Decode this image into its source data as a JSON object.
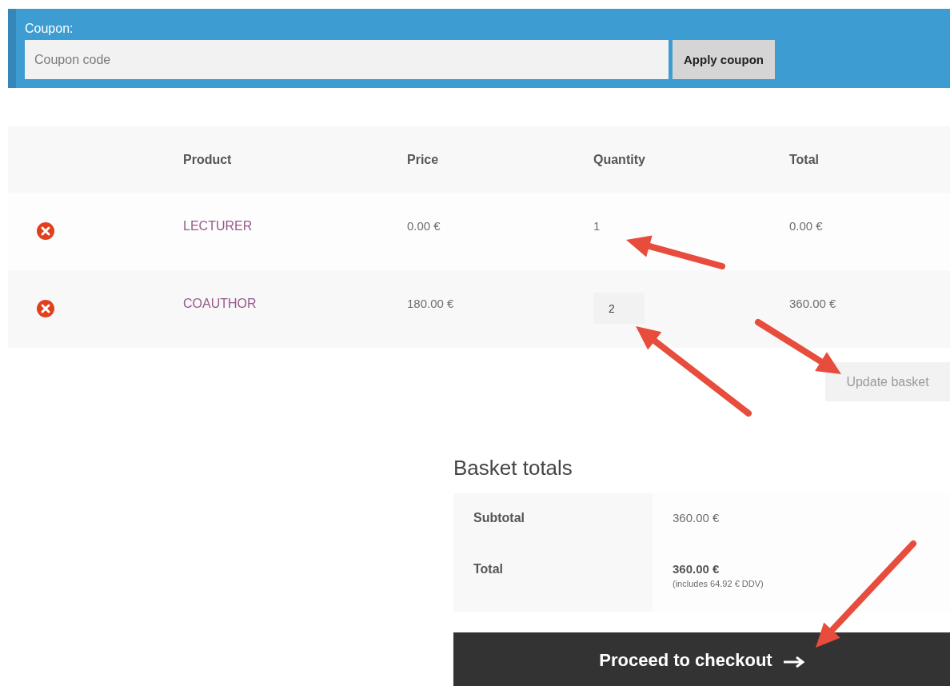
{
  "coupon": {
    "label": "Coupon:",
    "placeholder": "Coupon code",
    "button": "Apply coupon"
  },
  "cart": {
    "columns": [
      "Product",
      "Price",
      "Quantity",
      "Total"
    ],
    "rows": [
      {
        "product": "LECTURER",
        "price": "0.00 €",
        "quantity": "1",
        "editable": false,
        "total": "0.00 €"
      },
      {
        "product": "COAUTHOR",
        "price": "180.00 €",
        "quantity": "2",
        "editable": true,
        "total": "360.00 €"
      }
    ],
    "update_button": {
      "label": "Update basket",
      "disabled": true
    }
  },
  "totals": {
    "title": "Basket totals",
    "rows": [
      {
        "label": "Subtotal",
        "value": "360.00 €",
        "strong": false
      },
      {
        "label": "Total",
        "value": "360.00 €",
        "strong": true,
        "note": "(includes 64.92 € DDV)"
      }
    ],
    "checkout": "Proceed to checkout"
  }
}
